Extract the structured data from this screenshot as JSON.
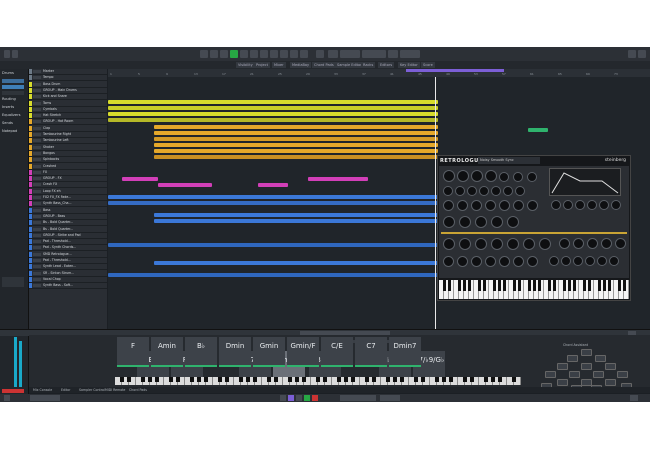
{
  "app": {
    "title": "Cubase",
    "accent": "#27a744"
  },
  "toolbar": {
    "buttons": [
      "play",
      "stop",
      "record",
      "cycle",
      "snap",
      "grid",
      "quantize",
      "zoom"
    ]
  },
  "tabs": [
    "Visibility",
    "Project",
    "Mixer",
    "MediaBay",
    "Chord Pads",
    "Sample Editor",
    "Racks",
    "Editors",
    "Key Editor",
    "Score"
  ],
  "inspector": {
    "track_label": "Drums",
    "sections": [
      "Routing",
      "Inserts",
      "Equalizers",
      "Sends",
      "Notepad"
    ]
  },
  "ruler": {
    "marks": [
      "1",
      "5",
      "9",
      "13",
      "17",
      "21",
      "25",
      "29",
      "33",
      "37",
      "41",
      "45",
      "49",
      "53",
      "57",
      "61",
      "65",
      "69",
      "73"
    ]
  },
  "tracks": [
    {
      "name": "Marker",
      "color": "#6d7a87"
    },
    {
      "name": "Tempo",
      "color": "#6d7a87"
    },
    {
      "name": "Bass Drum",
      "color": "#d7dc2c"
    },
    {
      "name": "GROUP - Main Drums",
      "color": "#d7dc2c"
    },
    {
      "name": "Kick and Snare",
      "color": "#d7dc2c"
    },
    {
      "name": "Toms",
      "color": "#d7dc2c"
    },
    {
      "name": "Cymbals",
      "color": "#d7dc2c"
    },
    {
      "name": "Hat Stretch",
      "color": "#d7dc2c"
    },
    {
      "name": "GROUP - Hat Room",
      "color": "#e5a82a"
    },
    {
      "name": "Clap",
      "color": "#e5a82a"
    },
    {
      "name": "Tambourine Right",
      "color": "#e5a82a"
    },
    {
      "name": "Tambourine Left",
      "color": "#e5a82a"
    },
    {
      "name": "Shaker",
      "color": "#e5a82a"
    },
    {
      "name": "Bongos",
      "color": "#e5a82a"
    },
    {
      "name": "Spinbacks",
      "color": "#e5a82a"
    },
    {
      "name": "Crashed",
      "color": "#e5a82a"
    },
    {
      "name": "FX",
      "color": "#d23fb8"
    },
    {
      "name": "GROUP - FX",
      "color": "#d23fb8"
    },
    {
      "name": "Crash FX",
      "color": "#d23fb8"
    },
    {
      "name": "Loop FX eh",
      "color": "#d23fb8"
    },
    {
      "name": "FX2 FX_FX Fade...",
      "color": "#d23fb8"
    },
    {
      "name": "Synth Bass_Cha...",
      "color": "#d23fb8"
    },
    {
      "name": "Bass",
      "color": "#3b78d8"
    },
    {
      "name": "GROUP - Bass",
      "color": "#3b78d8"
    },
    {
      "name": "Bs - Bold Quarter...",
      "color": "#3b78d8"
    },
    {
      "name": "Bs - Bold Quarter...",
      "color": "#3b78d8"
    },
    {
      "name": "GROUP - Strike and Pad",
      "color": "#3b78d8"
    },
    {
      "name": "Pad - Threshold...",
      "color": "#3b78d8"
    },
    {
      "name": "Pad - Synth Chords...",
      "color": "#3b78d8"
    },
    {
      "name": "SMD Retrologue...",
      "color": "#3b78d8"
    },
    {
      "name": "Pad - Threshold...",
      "color": "#3b78d8"
    },
    {
      "name": "Synth Lead - Eaten...",
      "color": "#3b78d8"
    },
    {
      "name": "SR - Sinton Strum...",
      "color": "#3b78d8"
    },
    {
      "name": "Vocal Chop",
      "color": "#3b78d8"
    },
    {
      "name": "Synth Bass - Soft...",
      "color": "#3b78d8"
    }
  ],
  "synth": {
    "title": "RETROLOGUE 2",
    "preset": "Noisy Smooth Sync",
    "brand": "steinberg"
  },
  "chord_pads": {
    "top_row": [
      {
        "label": "E7",
        "color": "#2fb36d"
      },
      {
        "label": "F7",
        "color": "#2fb36d"
      },
      {
        "label": "D7/♭9",
        "color": "#c8a036"
      },
      {
        "label": "Gmin7",
        "color": "#c8a036",
        "selected": true
      },
      {
        "label": "Bdim",
        "color": "#2fb36d"
      },
      {
        "label": "D♭dim7",
        "color": "#c8a036"
      },
      {
        "label": "C7/♭9/G♭",
        "color": "#2fb36d"
      }
    ],
    "bottom_row": [
      {
        "label": "F",
        "color": "#2fb36d"
      },
      {
        "label": "Amin",
        "color": "#2fb36d"
      },
      {
        "label": "B♭",
        "color": "#2fb36d"
      },
      {
        "label": "Dmin",
        "color": "#2fb36d"
      },
      {
        "label": "Gmin",
        "color": "#2fb36d"
      },
      {
        "label": "Gmin/F",
        "color": "#2fb36d"
      },
      {
        "label": "C/E",
        "color": "#2fb36d"
      },
      {
        "label": "C7",
        "color": "#2fb36d"
      },
      {
        "label": "Dmin7",
        "color": "#2fb36d"
      }
    ]
  },
  "bottom_tabs": [
    "Mix Console",
    "Editor",
    "Sampler Control",
    "MIDI Remote",
    "Chord Pads"
  ],
  "chord_wheel": {
    "title": "Chord Assistant"
  }
}
